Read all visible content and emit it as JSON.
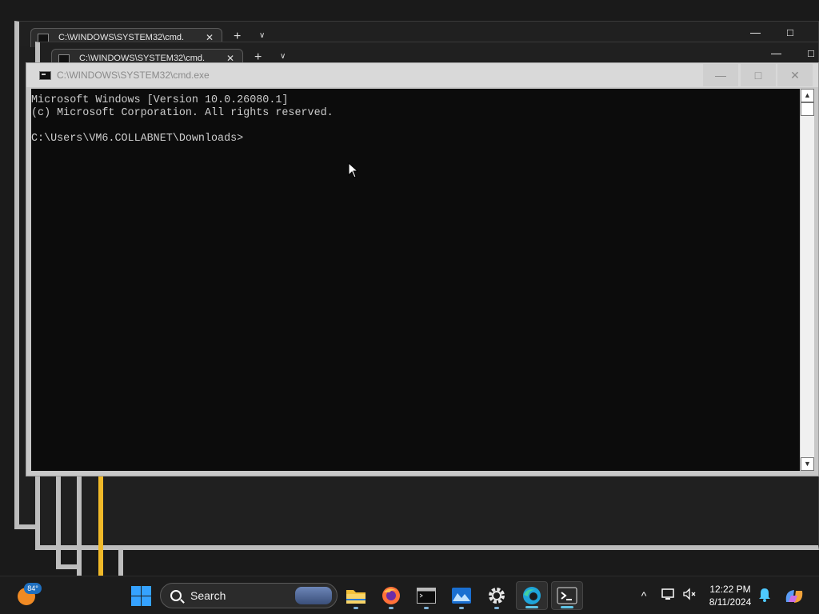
{
  "background_windows": [
    {
      "tab_title": "C:\\WINDOWS\\SYSTEM32\\cmd.",
      "new_tab_glyph": "+",
      "tab_menu_glyph": "∨",
      "minimize_glyph": "—",
      "maximize_glyph": "□"
    },
    {
      "tab_title": "C:\\WINDOWS\\SYSTEM32\\cmd.",
      "new_tab_glyph": "+",
      "tab_menu_glyph": "∨",
      "minimize_glyph": "—",
      "maximize_glyph": "□"
    }
  ],
  "console": {
    "title": "C:\\WINDOWS\\SYSTEM32\\cmd.exe",
    "minimize_glyph": "—",
    "maximize_glyph": "□",
    "close_glyph": "✕",
    "lines": [
      "Microsoft Windows [Version 10.0.26080.1]",
      "(c) Microsoft Corporation. All rights reserved.",
      "",
      "C:\\Users\\VM6.COLLABNET\\Downloads>"
    ],
    "scroll_up_glyph": "▲",
    "scroll_down_glyph": "▼"
  },
  "taskbar": {
    "weather_temp": "84°",
    "search_label": "Search",
    "pinned_apps": [
      "file-explorer",
      "firefox",
      "command-prompt",
      "photo-app",
      "settings",
      "edge",
      "terminal"
    ],
    "tray": {
      "overflow_glyph": "^",
      "time": "12:22 PM",
      "date": "8/11/2024"
    }
  },
  "colors": {
    "console_bg": "#0c0c0c",
    "console_text": "#cccccc",
    "taskbar_bg": "#1c1c1c",
    "accent": "#35a2ff"
  }
}
